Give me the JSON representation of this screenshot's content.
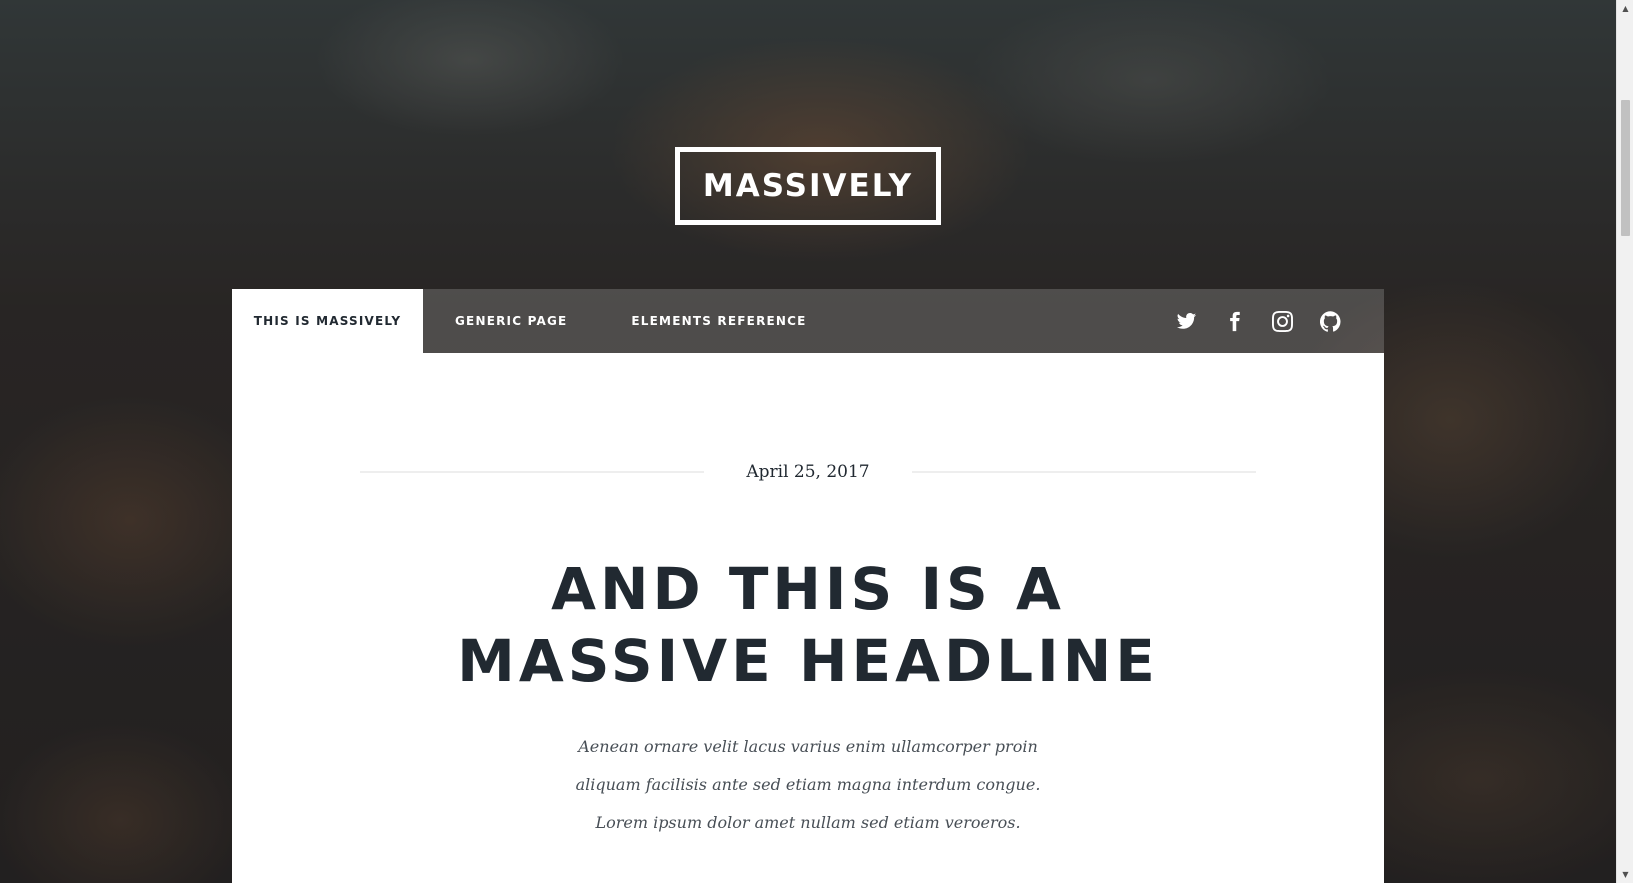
{
  "site": {
    "logo_text": "MASSIVELY"
  },
  "nav": {
    "items": [
      {
        "label": "THIS IS MASSIVELY",
        "active": true
      },
      {
        "label": "GENERIC PAGE",
        "active": false
      },
      {
        "label": "ELEMENTS REFERENCE",
        "active": false
      }
    ],
    "icons": [
      "twitter-icon",
      "facebook-icon",
      "instagram-icon",
      "github-icon"
    ]
  },
  "post": {
    "date": "April 25, 2017",
    "headline_line1": "AND THIS IS A",
    "headline_line2": "MASSIVE HEADLINE",
    "intro": "Aenean ornare velit lacus varius enim ullamcorper proin aliquam facilisis ante sed etiam magna interdum congue. Lorem ipsum dolor amet nullam sed etiam veroeros."
  },
  "colors": {
    "text_dark": "#212931",
    "body_text": "#484f56",
    "panel": "#ffffff"
  }
}
